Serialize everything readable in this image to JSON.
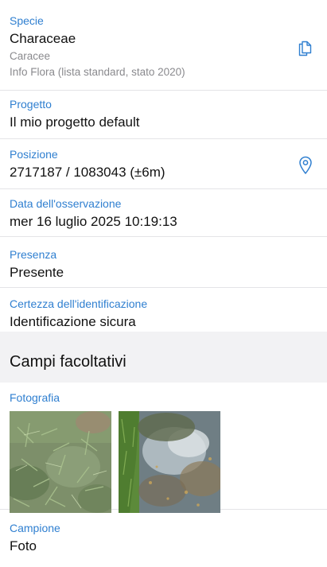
{
  "fields": {
    "specie": {
      "label": "Specie",
      "value": "Characeae",
      "common_name": "Caracee",
      "source": "Info Flora (lista standard, stato 2020)",
      "icon": "copy-icon"
    },
    "progetto": {
      "label": "Progetto",
      "value": "Il mio progetto default"
    },
    "posizione": {
      "label": "Posizione",
      "value": "2717187 / 1083043 (±6m)",
      "icon": "location-pin-icon"
    },
    "data": {
      "label": "Data dell'osservazione",
      "value": "mer 16 luglio 2025 10:19:13"
    },
    "presenza": {
      "label": "Presenza",
      "value": "Presente"
    },
    "certezza": {
      "label": "Certezza dell'identificazione",
      "value": "Identificazione sicura"
    }
  },
  "optional_section": {
    "title": "Campi facoltativi",
    "fotografia": {
      "label": "Fotografia"
    },
    "campione": {
      "label": "Campione",
      "value": "Foto"
    }
  },
  "colors": {
    "accent": "#2f7fd0",
    "section_bg": "#f2f2f4",
    "divider": "#e4e4e7"
  }
}
